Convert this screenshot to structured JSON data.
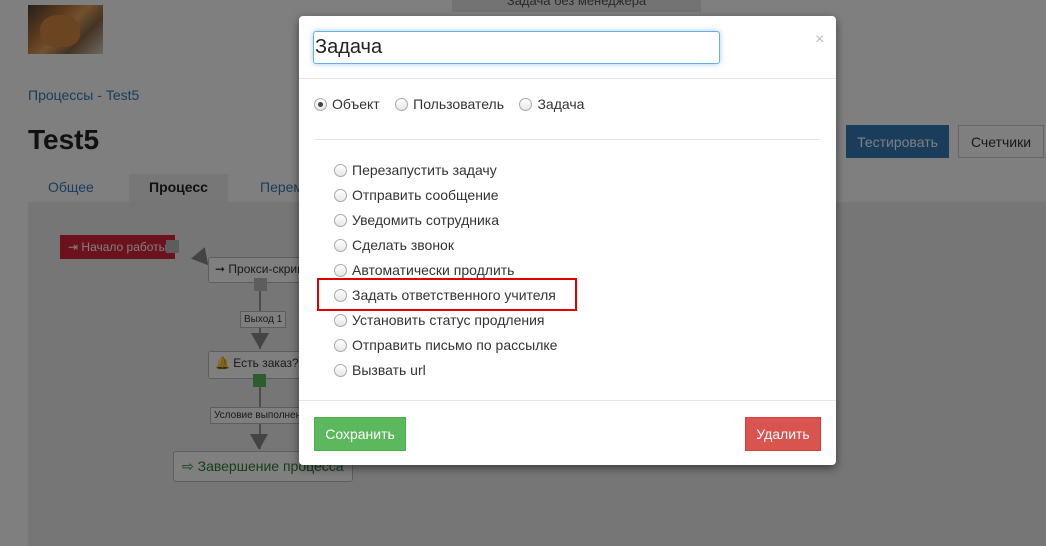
{
  "header": {
    "top_tab_label": "Задача без менеджера",
    "breadcrumb": {
      "parent": "Процессы",
      "separator": " - ",
      "current": "Test5"
    },
    "title": "Test5",
    "buttons": {
      "test": "Тестировать",
      "counters": "Счетчики"
    }
  },
  "tabs": [
    {
      "label": "Общее"
    },
    {
      "label": "Процесс",
      "active": true
    },
    {
      "label": "Перем"
    }
  ],
  "diagram": {
    "nodes": {
      "start": "Начало работы",
      "proxy": "Прокси-скрип",
      "order": "Есть заказ?",
      "end": "Завершение процесса"
    },
    "edges": {
      "out1": "Выход 1",
      "condition": "Условие выполнен"
    }
  },
  "modal": {
    "title_value": "Задача",
    "close_glyph": "×",
    "types": [
      {
        "label": "Объект",
        "checked": true
      },
      {
        "label": "Пользователь",
        "checked": false
      },
      {
        "label": "Задача",
        "checked": false
      }
    ],
    "actions": [
      {
        "label": "Перезапустить задачу"
      },
      {
        "label": "Отправить сообщение"
      },
      {
        "label": "Уведомить сотрудника"
      },
      {
        "label": "Сделать звонок"
      },
      {
        "label": "Автоматически продлить"
      },
      {
        "label": "Задать ответственного учителя",
        "highlighted": true
      },
      {
        "label": "Установить статус продления"
      },
      {
        "label": "Отправить письмо по рассылке"
      },
      {
        "label": "Вызвать url"
      }
    ],
    "footer": {
      "save": "Сохранить",
      "delete": "Удалить"
    }
  },
  "colors": {
    "primary": "#337ab7",
    "success": "#5cb85c",
    "danger": "#d9534f",
    "start_node": "#d9243b",
    "highlight": "#e00000"
  }
}
